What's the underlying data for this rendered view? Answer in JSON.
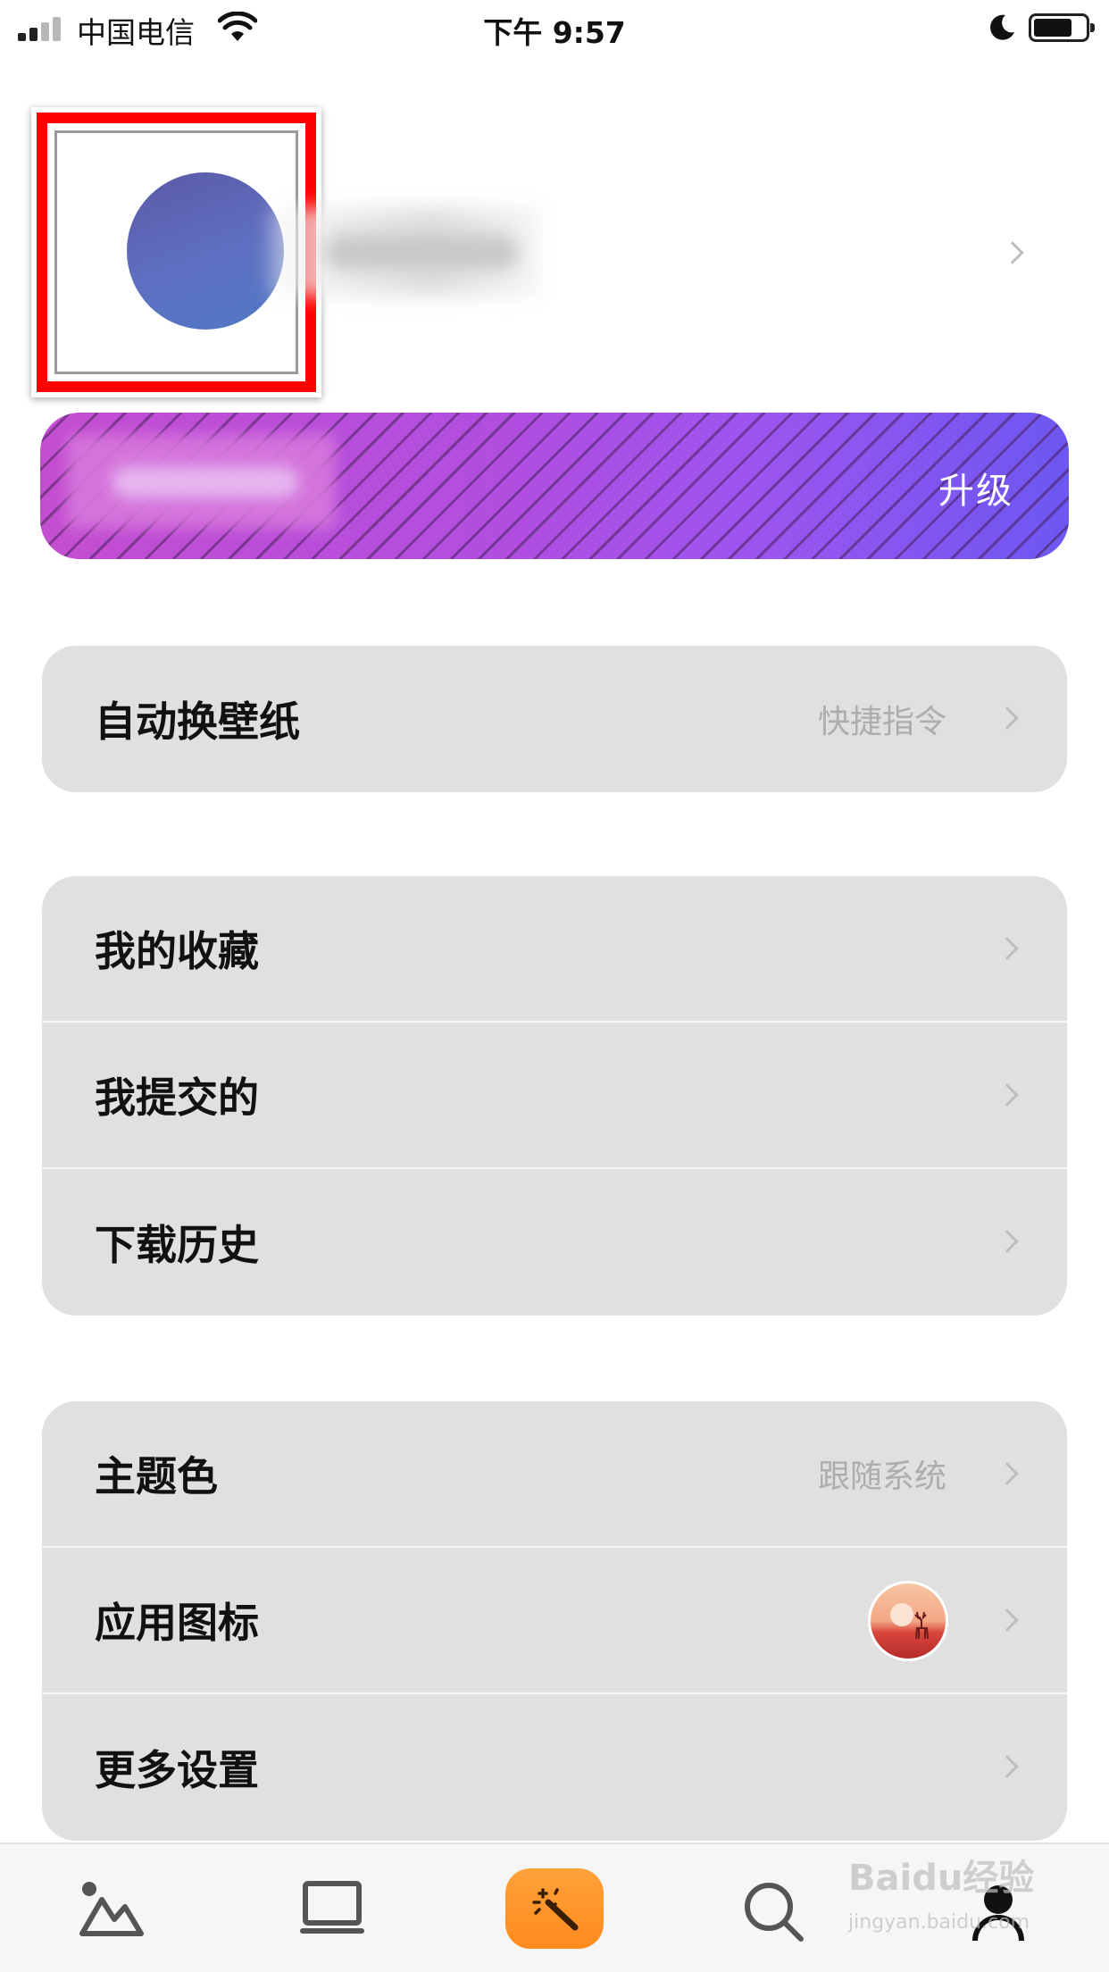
{
  "status_bar": {
    "carrier": "中国电信",
    "time": "下午 9:57"
  },
  "profile": {
    "icons": [
      "avatar",
      "chevron-right-icon"
    ]
  },
  "vip_banner": {
    "upgrade_label": "升级"
  },
  "groups": [
    {
      "rows": [
        {
          "label": "自动换壁纸",
          "value": "快捷指令"
        }
      ]
    },
    {
      "rows": [
        {
          "label": "我的收藏"
        },
        {
          "label": "我提交的"
        },
        {
          "label": "下载历史"
        }
      ]
    },
    {
      "rows": [
        {
          "label": "主题色",
          "value": "跟随系统"
        },
        {
          "label": "应用图标"
        },
        {
          "label": "更多设置"
        }
      ]
    }
  ],
  "tab_bar": {
    "tabs": [
      "wallpaper-tab-icon",
      "desktop-tab-icon",
      "magic-wand-tab-icon",
      "search-tab-icon",
      "profile-tab-icon"
    ],
    "accent": "#ff931f"
  },
  "watermark": {
    "brand": "Baidu经验",
    "url": "jingyan.baidu.com"
  }
}
